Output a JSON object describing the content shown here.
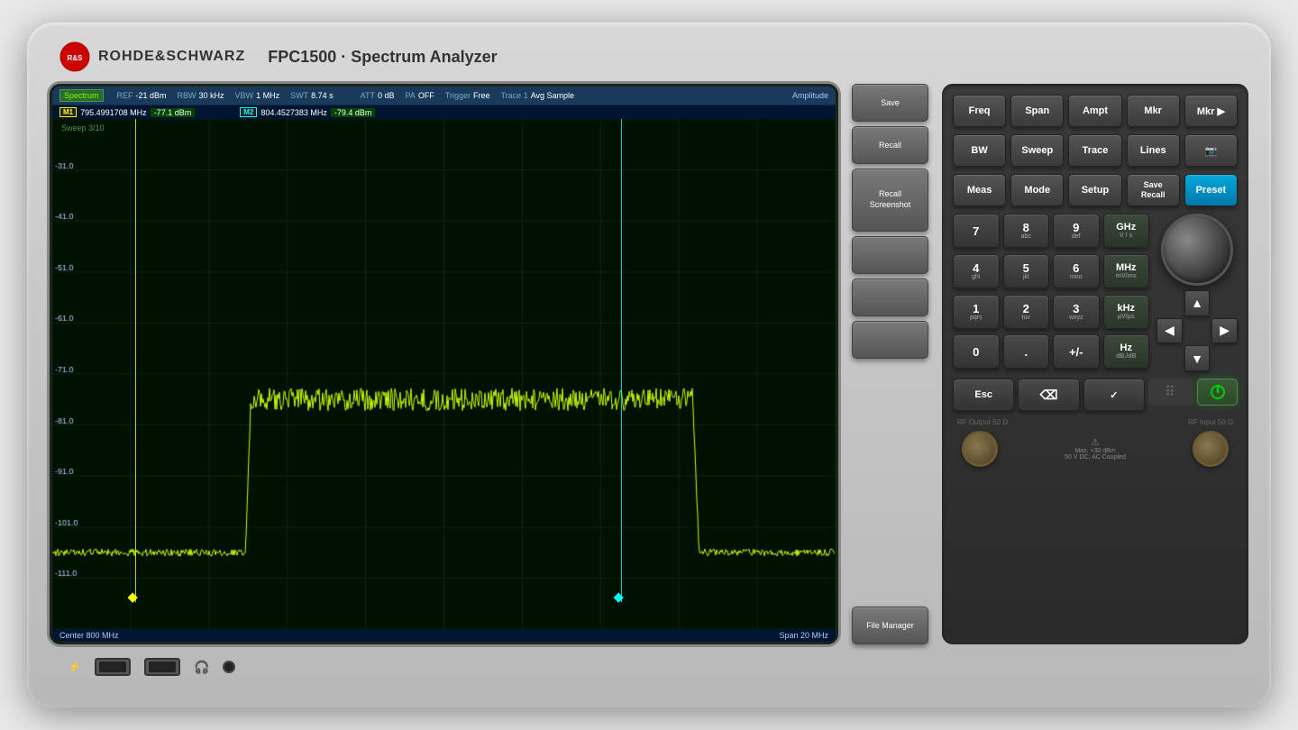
{
  "device": {
    "brand": "ROHDE&SCHWARZ",
    "model": "FPC1500",
    "type": "Spectrum Analyzer"
  },
  "screen": {
    "title": "Spectrum",
    "amplitude_label": "Amplitude",
    "params": {
      "ref": {
        "label": "REF",
        "value": "-21 dBm"
      },
      "rbw": {
        "label": "RBW",
        "value": "30 kHz"
      },
      "vbw": {
        "label": "VBW",
        "value": "1 MHz"
      },
      "swt": {
        "label": "SWT",
        "value": "8.74 s"
      },
      "att": {
        "label": "ATT",
        "value": "0 dB"
      },
      "pa": {
        "label": "PA",
        "value": "OFF"
      },
      "trigger": {
        "label": "Trigger",
        "value": "Free"
      },
      "trace": {
        "label": "Trace 1",
        "value": "Avg Sample"
      }
    },
    "markers": {
      "m1": {
        "label": "M1",
        "freq": "795.4991708 MHz",
        "amp": "-77.1 dBm"
      },
      "m2": {
        "label": "M2",
        "freq": "804.4527383 MHz",
        "amp": "-79.4 dBm"
      }
    },
    "sweep_label": "Sweep 3/10",
    "footer": {
      "center": "Center 800 MHz",
      "span": "Span 20 MHz"
    },
    "y_labels": [
      "-31.0",
      "-41.0",
      "-51.0",
      "-61.0",
      "-71.0",
      "-81.0",
      "-91.0",
      "-101.0",
      "-111.0"
    ]
  },
  "softkeys": {
    "buttons": [
      "Save",
      "Recall",
      "Recall\nScreenshot",
      "",
      "",
      "",
      "File Manager"
    ]
  },
  "func_keys_row1": [
    "Freq",
    "Span",
    "Ampt",
    "Mkr",
    "Mkr ▶"
  ],
  "func_keys_row2": [
    "BW",
    "Sweep",
    "Trace",
    "Lines",
    "📷"
  ],
  "func_keys_row3": [
    "Meas",
    "Mode",
    "Setup",
    "Save\nRecall",
    "Preset"
  ],
  "numpad": {
    "keys": [
      {
        "main": "7",
        "sub": ""
      },
      {
        "main": "8",
        "sub": "abc"
      },
      {
        "main": "9",
        "sub": "def"
      },
      {
        "main": "GHz",
        "sub": "V\ns"
      },
      {
        "main": "4",
        "sub": "ghi"
      },
      {
        "main": "5",
        "sub": "jkl"
      },
      {
        "main": "6",
        "sub": "mno"
      },
      {
        "main": "MHz",
        "sub": "mV\nms"
      },
      {
        "main": "1",
        "sub": "pqrs"
      },
      {
        "main": "2",
        "sub": "tuv"
      },
      {
        "main": "3",
        "sub": "wxyz"
      },
      {
        "main": "kHz",
        "sub": "μV\nμs"
      },
      {
        "main": "0",
        "sub": ""
      },
      {
        "main": ".",
        "sub": ""
      },
      {
        "main": "+/-",
        "sub": ""
      },
      {
        "main": "Hz",
        "sub": "dB.\ndB"
      }
    ]
  },
  "action_keys": [
    "Esc",
    "⌫",
    "✓"
  ],
  "navigation": {
    "up": "▲",
    "down": "▼",
    "left": "◀",
    "right": "▶"
  },
  "ports": {
    "rf_output": "RF Output 50 Ω",
    "rf_input": "RF Input 50 Ω",
    "warning": "Max. +30 dBm\n50 V DC, AC Coupled"
  },
  "colors": {
    "screen_bg": "#001100",
    "trace_color": "#ccff00",
    "grid_color": "#1a3a1a",
    "marker1": "#ffff00",
    "marker2": "#00ffff",
    "preset_active": "#00aadd"
  }
}
